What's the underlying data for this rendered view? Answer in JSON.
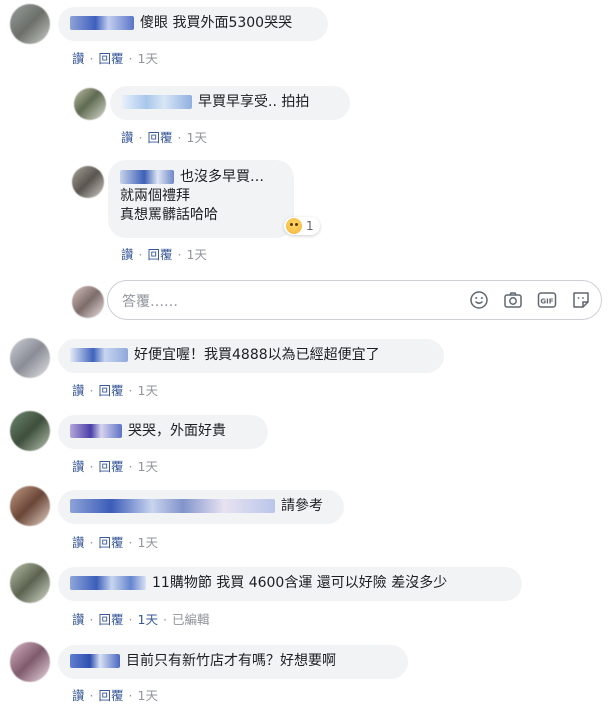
{
  "actions": {
    "like": "讚",
    "reply": "回覆",
    "edited": "已編輯"
  },
  "separator": "·",
  "comments": [
    {
      "text": "傻眼 我買外面5300哭哭",
      "time": "1天"
    },
    {
      "text": "早買早享受.. 拍拍",
      "time": "1天"
    },
    {
      "line1": "也沒多早買…",
      "line2": "就兩個禮拜",
      "line3": "真想罵髒話哈哈",
      "time": "1天",
      "reaction_count": "1"
    },
    {
      "text": "好便宜喔！我買4888以為已經超便宜了",
      "time": "1天"
    },
    {
      "text": "哭哭，外面好貴",
      "time": "1天"
    },
    {
      "text": "請參考",
      "time": "1天"
    },
    {
      "text": "11購物節 我買 4600含運 還可以好險 差沒多少",
      "time": "1天"
    },
    {
      "text": "目前只有新竹店才有嗎？好想要啊",
      "time": "1天"
    }
  ],
  "reply_input": {
    "placeholder": "答覆……"
  },
  "icons": [
    "emoji-icon",
    "camera-icon",
    "gif-icon",
    "sticker-icon"
  ]
}
